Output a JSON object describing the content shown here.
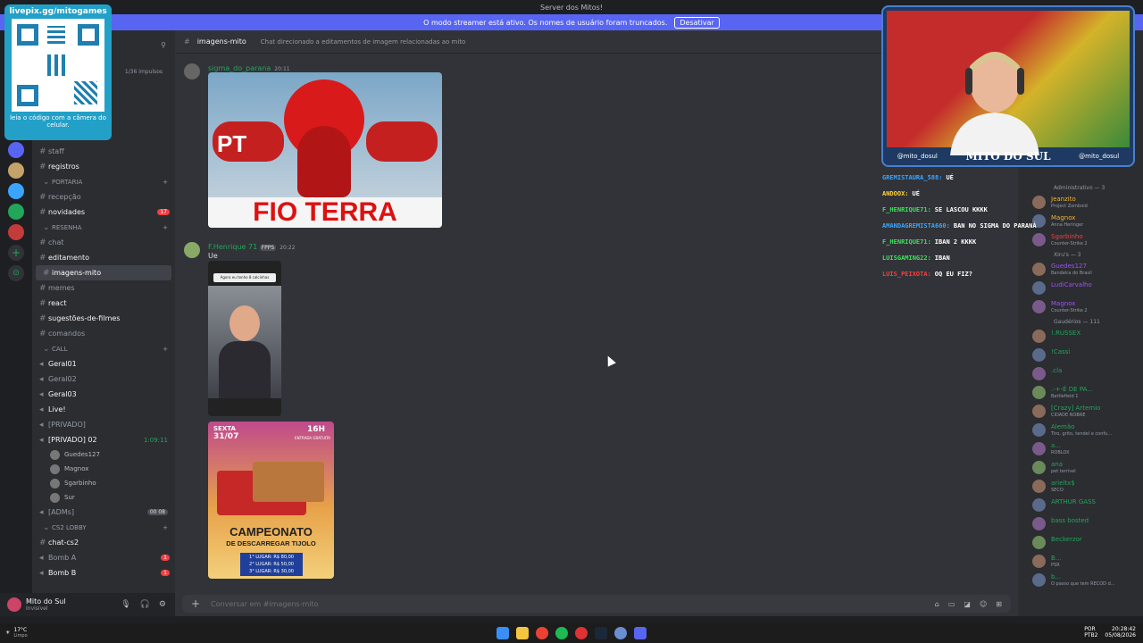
{
  "window": {
    "title": "Server dos Mitos!"
  },
  "stream_banner": {
    "text": "O modo streamer está ativo. Os nomes de usuário foram truncados.",
    "button": "Desativar"
  },
  "sidebar": {
    "boosts": "1/36 impulsos",
    "items": [
      {
        "label": "staff",
        "type": "channel"
      },
      {
        "label": "registros",
        "type": "channel"
      },
      {
        "label": "PORTARIA",
        "type": "category"
      },
      {
        "label": "recepção",
        "type": "channel"
      },
      {
        "label": "novidades",
        "type": "channel",
        "badge": "17"
      },
      {
        "label": "RESENHA",
        "type": "category"
      },
      {
        "label": "chat",
        "type": "channel"
      },
      {
        "label": "editamento",
        "type": "channel"
      },
      {
        "label": "imagens-mito",
        "type": "channel",
        "active": true
      },
      {
        "label": "memes",
        "type": "channel"
      },
      {
        "label": "react",
        "type": "channel"
      },
      {
        "label": "sugestões-de-filmes",
        "type": "channel"
      },
      {
        "label": "comandos",
        "type": "channel"
      },
      {
        "label": "CALL",
        "type": "category"
      },
      {
        "label": "Geral01",
        "type": "voice"
      },
      {
        "label": "Geral02",
        "type": "voice"
      },
      {
        "label": "Geral03",
        "type": "voice"
      },
      {
        "label": "Live!",
        "type": "voice"
      },
      {
        "label": "[PRIVADO]",
        "type": "voice"
      },
      {
        "label": "[PRIVADO] 02",
        "type": "voice",
        "time": "1:09:11"
      }
    ],
    "voice_users": [
      "Guedes127",
      "Magnox",
      "Sgarbinho",
      "Sur"
    ],
    "more": [
      {
        "label": "[ADMs]",
        "type": "voice",
        "tag": "00 08"
      },
      {
        "label": "CS2 LOBBY",
        "type": "category"
      },
      {
        "label": "chat-cs2",
        "type": "channel"
      },
      {
        "label": "Bomb A",
        "type": "voice",
        "badge": "1"
      },
      {
        "label": "Bomb B",
        "type": "voice",
        "badge": "1"
      }
    ]
  },
  "user_panel": {
    "name": "Mito do Sul",
    "status": "Invisível"
  },
  "channel": {
    "name": "imagens-mito",
    "topic": "Chat direcionado a editamentos de imagem relacionadas ao mito"
  },
  "messages": [
    {
      "author": "sigma_do_parana",
      "time": "20:11",
      "color": "#23a55a"
    },
    {
      "author": "F.Henrique 71",
      "tag": "FPPS",
      "time": "20:22",
      "text": "Ue",
      "color": "#23a55a"
    }
  ],
  "meme": {
    "tag": "PT",
    "caption": "FIO TERRA"
  },
  "phone_caption": "Agora eu tenho 8 calcinhas",
  "poster": {
    "day": "SEXTA",
    "date": "31/07",
    "hour": "16H",
    "entry": "ENTRADA GRATUITA",
    "title": "CAMPEONATO",
    "subtitle": "DE DESCARREGAR TIJOLO",
    "prizes": [
      "1° LUGAR: R$ 80,00",
      "2° LUGAR: R$ 50,00",
      "3° LUGAR: R$ 30,00"
    ]
  },
  "composer": {
    "placeholder": "Conversar em #imagens-mito"
  },
  "overlay": {
    "qr_top": "livepix.gg/mitogames",
    "qr_bottom": "leia o código com a câmera do celular.",
    "cam_left": "@mito_dosul",
    "cam_name": "MITO DO SUL",
    "cam_right": "@mito_dosul",
    "chat": [
      {
        "user": "GREMISTAURA_588:",
        "msg": "UÉ",
        "color": "#3aa5ff"
      },
      {
        "user": "ANDOOX:",
        "msg": "UÉ",
        "color": "#ffd23f"
      },
      {
        "user": "F_HENRIQUE71:",
        "msg": "SE LASCOU KKKK",
        "color": "#3ee25a"
      },
      {
        "user": "AMANDAGREMISTA660:",
        "msg": "BAN NO SIGMA DO PARANÁ",
        "color": "#3aa5ff"
      },
      {
        "user": "F_HENRIQUE71:",
        "msg": "IBAN 2 KKKK",
        "color": "#3ee25a"
      },
      {
        "user": "LUISGAMING22:",
        "msg": "IBAN",
        "color": "#3ee25a"
      },
      {
        "user": "LUIS_PEIXOTA:",
        "msg": "OQ EU FIZ?",
        "color": "#ff3b3b"
      }
    ]
  },
  "members": {
    "groups": [
      {
        "title": "Administrativo — 3",
        "members": [
          {
            "name": "Jeanzito",
            "status": "Project Zomboid",
            "color": "#f0b232"
          },
          {
            "name": "Magnox",
            "status": "Anna Heringer",
            "color": "#f0b232"
          },
          {
            "name": "Sgarbinho",
            "status": "Counter-Strike 2",
            "color": "#f23f43"
          }
        ]
      },
      {
        "title": "Xiru's — 3",
        "members": [
          {
            "name": "Guedes127",
            "status": "Bandeira do Brasil",
            "color": "#a051f5"
          },
          {
            "name": "LudiCarvalho",
            "status": "",
            "color": "#a051f5"
          },
          {
            "name": "Magnox",
            "status": "Counter-Strike 2",
            "color": "#a051f5"
          }
        ]
      },
      {
        "title": "Gaudérios — 111",
        "members": [
          {
            "name": "!.RUSSEX",
            "status": "",
            "color": "#23a55a"
          },
          {
            "name": "!Cassi",
            "status": "",
            "color": "#23a55a"
          },
          {
            "name": ".cla",
            "status": "",
            "color": "#23a55a"
          },
          {
            "name": ".-+-É DE PA...",
            "status": "Battlefield 1",
            "color": "#23a55a"
          },
          {
            "name": "[Crazy] Artemio",
            "status": "CIDADE NOBRE",
            "color": "#23a55a"
          },
          {
            "name": "Alemão",
            "status": "Tiro, grito, tendel e confu...",
            "color": "#23a55a"
          },
          {
            "name": "a...",
            "status": "ROBLOX",
            "color": "#23a55a"
          },
          {
            "name": "ana",
            "status": "pet terrível",
            "color": "#23a55a"
          },
          {
            "name": "arieltx$",
            "status": "SECO",
            "color": "#23a55a"
          },
          {
            "name": "ARTHUR GASS",
            "status": "",
            "color": "#23a55a"
          },
          {
            "name": "bass bosted",
            "status": "",
            "color": "#23a55a"
          },
          {
            "name": "Beckerzor",
            "status": "",
            "color": "#23a55a"
          },
          {
            "name": "B...",
            "status": "PSR",
            "color": "#23a55a"
          },
          {
            "name": "b...",
            "status": "O passo que tem RECOD d...",
            "color": "#23a55a"
          }
        ]
      }
    ]
  },
  "taskbar": {
    "weather": "17°C",
    "weather_desc": "Limpo",
    "lang": "POR",
    "kb": "PTB2",
    "time": "20:28:42",
    "date": "05/08/2026"
  },
  "accent": "#5865f2"
}
